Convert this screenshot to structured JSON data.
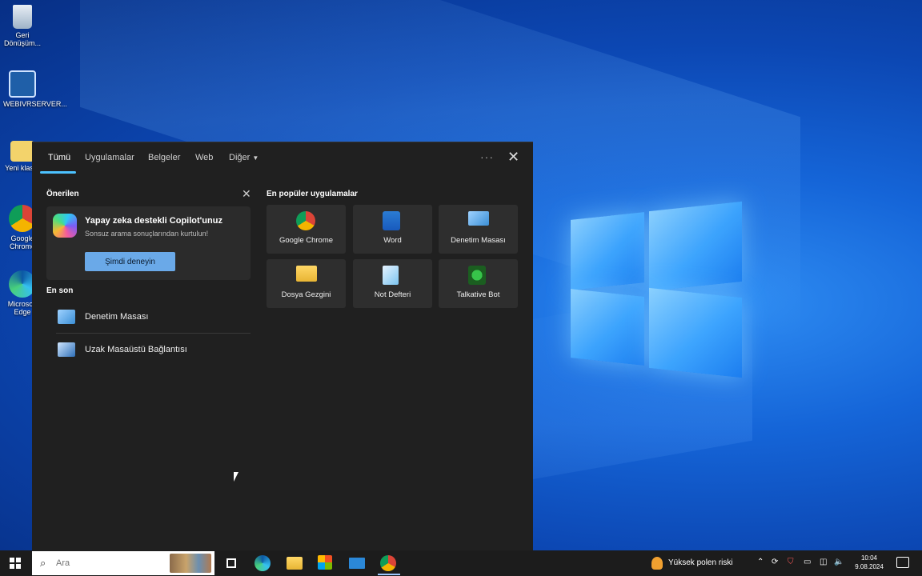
{
  "desktop": {
    "icons": [
      {
        "name": "recycle-bin-icon",
        "label": "Geri Dönüşüm..."
      },
      {
        "name": "wdsvc-icon",
        "label": "WEBIVRSERVER..."
      },
      {
        "name": "folder-icon",
        "label": "Yeni klasör"
      },
      {
        "name": "chrome-icon",
        "label": "Google Chrome"
      },
      {
        "name": "edge-icon",
        "label": "Microsoft Edge"
      }
    ]
  },
  "panel": {
    "tabs": [
      "Tümü",
      "Uygulamalar",
      "Belgeler",
      "Web",
      "Diğer"
    ],
    "more_label": "···",
    "close_label": "✕",
    "suggested_title": "Önerilen",
    "suggested_close": "✕",
    "copilot": {
      "title": "Yapay zeka destekli Copilot'unuz",
      "subtitle": "Sonsuz arama sonuçlarından kurtulun!",
      "button": "Şimdi deneyin"
    },
    "recent_title": "En son",
    "recent": [
      {
        "label": "Denetim Masası",
        "icon": "control-panel-icon"
      },
      {
        "label": "Uzak Masaüstü Bağlantısı",
        "icon": "remote-desktop-icon"
      }
    ],
    "popular_title": "En popüler uygulamalar",
    "popular": [
      {
        "label": "Google Chrome",
        "icon": "chrome-icon"
      },
      {
        "label": "Word",
        "icon": "word-icon"
      },
      {
        "label": "Denetim Masası",
        "icon": "control-panel-icon"
      },
      {
        "label": "Dosya Gezgini",
        "icon": "file-explorer-icon"
      },
      {
        "label": "Not Defteri",
        "icon": "notepad-icon"
      },
      {
        "label": "Talkative Bot",
        "icon": "talkative-bot-icon"
      }
    ]
  },
  "taskbar": {
    "search_placeholder": "Ara",
    "weather": "Yüksek polen riski",
    "time": "10:04",
    "date": "9.08.2024"
  },
  "colors": {
    "accent": "#4cc2ff",
    "panel_bg": "#202020",
    "tile_bg": "#2e2e2e",
    "button_bg": "#6aa9e8"
  }
}
